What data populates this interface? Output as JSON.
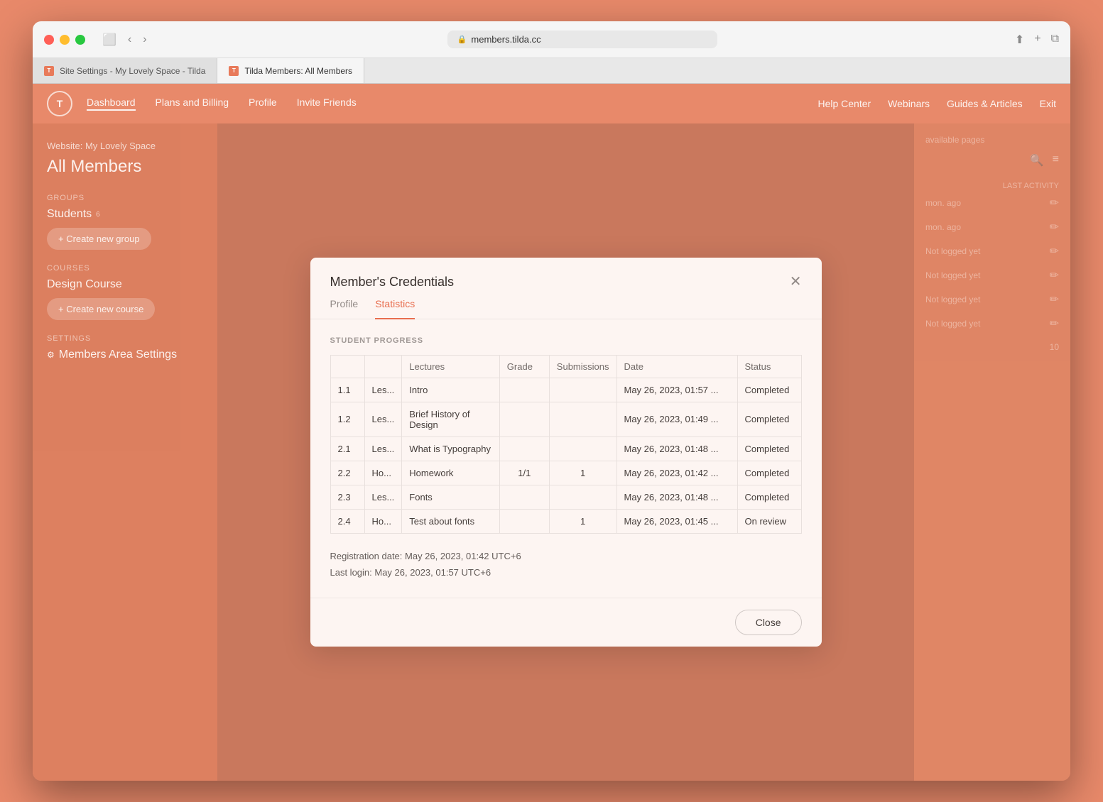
{
  "window": {
    "url": "members.tilda.cc",
    "tab1_label": "Site Settings - My Lovely Space - Tilda",
    "tab2_label": "Tilda Members: All Members"
  },
  "nav": {
    "logo": "T",
    "links": [
      "Dashboard",
      "Plans and Billing",
      "Profile",
      "Invite Friends"
    ],
    "right_links": [
      "Help Center",
      "Webinars",
      "Guides & Articles",
      "Exit"
    ]
  },
  "sidebar": {
    "website_label": "Website: My Lovely Space",
    "title": "All Members",
    "groups_label": "GROUPS",
    "group_name": "Students",
    "create_group_btn": "+ Create new group",
    "courses_label": "COURSES",
    "course_name": "Design Course",
    "create_course_btn": "+ Create new course",
    "settings_label": "SETTINGS",
    "settings_item": "Members Area Settings"
  },
  "modal": {
    "title": "Member's Credentials",
    "tab_profile": "Profile",
    "tab_statistics": "Statistics",
    "section_label": "STUDENT PROGRESS",
    "table": {
      "headers": [
        "",
        "",
        "Lectures",
        "Grade",
        "Submissions",
        "Date",
        "Status"
      ],
      "rows": [
        {
          "num": "1.1",
          "type": "Les...",
          "lecture": "Intro",
          "grade": "",
          "submissions": "",
          "date": "May 26, 2023, 01:57 ...",
          "status": "Completed"
        },
        {
          "num": "1.2",
          "type": "Les...",
          "lecture": "Brief History of Design",
          "grade": "",
          "submissions": "",
          "date": "May 26, 2023, 01:49 ...",
          "status": "Completed"
        },
        {
          "num": "2.1",
          "type": "Les...",
          "lecture": "What is Typography",
          "grade": "",
          "submissions": "",
          "date": "May 26, 2023, 01:48 ...",
          "status": "Completed"
        },
        {
          "num": "2.2",
          "type": "Ho...",
          "lecture": "Homework",
          "grade": "1/1",
          "submissions": "1",
          "date": "May 26, 2023, 01:42 ...",
          "status": "Completed"
        },
        {
          "num": "2.3",
          "type": "Les...",
          "lecture": "Fonts",
          "grade": "",
          "submissions": "",
          "date": "May 26, 2023, 01:48 ...",
          "status": "Completed"
        },
        {
          "num": "2.4",
          "type": "Ho...",
          "lecture": "Test about fonts",
          "grade": "",
          "submissions": "1",
          "date": "May 26, 2023, 01:45 ...",
          "status": "On review"
        }
      ]
    },
    "registration_date": "Registration date: May 26, 2023, 01:42 UTC+6",
    "last_login": "Last login: May 26, 2023, 01:57 UTC+6",
    "close_btn": "Close"
  }
}
